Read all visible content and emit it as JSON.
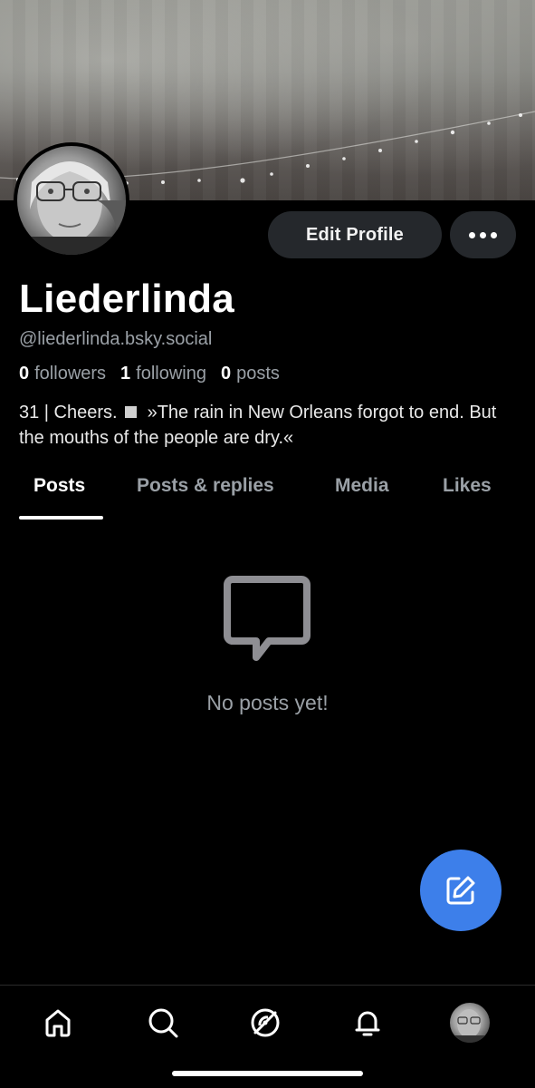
{
  "profile": {
    "display_name": "Liederlinda",
    "handle": "@liederlinda.bsky.social",
    "followers_count": "0",
    "followers_label": "followers",
    "following_count": "1",
    "following_label": "following",
    "posts_count": "0",
    "posts_label": "posts",
    "bio_part1": "31 | Cheers.",
    "bio_part2": "»The rain in New Orleans forgot to end. But the mouths of the people are dry.«"
  },
  "actions": {
    "edit_profile_label": "Edit Profile",
    "more_icon": "more-horizontal-icon"
  },
  "tabs": [
    {
      "label": "Posts",
      "active": true
    },
    {
      "label": "Posts & replies",
      "active": false
    },
    {
      "label": "Media",
      "active": false
    },
    {
      "label": "Likes",
      "active": false
    }
  ],
  "empty_state": {
    "icon": "message-bubble-icon",
    "text": "No posts yet!"
  },
  "fab": {
    "icon": "compose-icon",
    "color": "#3d7fea"
  },
  "bottom_nav": [
    {
      "icon": "home-icon"
    },
    {
      "icon": "search-icon"
    },
    {
      "icon": "feeds-icon"
    },
    {
      "icon": "notifications-icon"
    },
    {
      "icon": "profile-avatar"
    }
  ],
  "colors": {
    "background": "#000000",
    "secondary_text": "#9aa0a6",
    "button_bg": "#25282c",
    "accent": "#3d7fea"
  }
}
